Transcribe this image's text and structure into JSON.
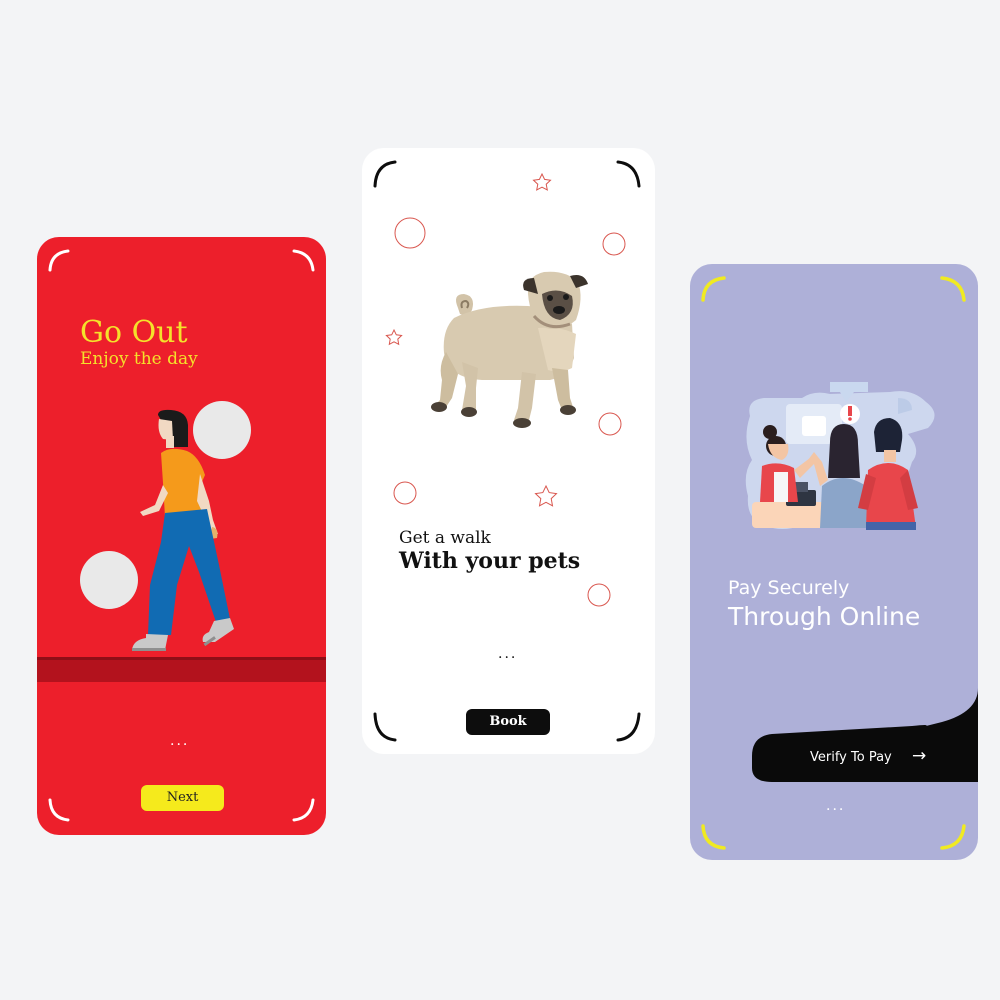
{
  "screens": [
    {
      "id": "go-out",
      "background": "#ed1f2b",
      "heading": "Go Out",
      "subheading": "Enjoy the day",
      "pager_dots": "...",
      "button_label": "Next",
      "accent": "#f4e22b",
      "illustration": "woman-walking-icon"
    },
    {
      "id": "pet-walk",
      "background": "#ffffff",
      "line1": "Get a walk",
      "line2": "With your pets",
      "pager_dots": "...",
      "button_label": "Book",
      "illustration": "pug-dog-icon"
    },
    {
      "id": "pay",
      "background": "#aeb0d8",
      "line1": "Pay Securely",
      "line2": "Through Online",
      "button_label": "Verify To Pay",
      "button_icon": "arrow-right-icon",
      "pager_dots": "...",
      "accent": "#f0ea21",
      "illustration": "shop-checkout-icon"
    }
  ]
}
